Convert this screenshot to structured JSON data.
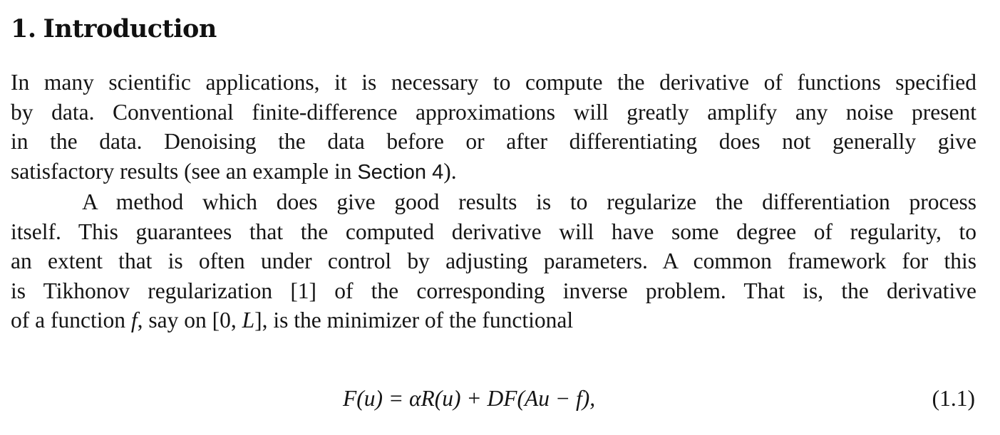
{
  "section": {
    "number": "1.",
    "title": "Introduction"
  },
  "paragraph1": {
    "line1": "In many scientific applications, it is necessary to compute the derivative of functions specified",
    "line2": "by data. Conventional finite-difference approximations will greatly amplify any noise present",
    "line3": "in the data. Denoising the data before or after differentiating does not generally give",
    "line4_pre": "satisfactory results (see an example in ",
    "line4_ref": "Section 4",
    "line4_post": ")."
  },
  "paragraph2": {
    "line1": "A method which does give good results is to regularize the differentiation process",
    "line2": "itself. This guarantees that the computed derivative will have some degree of regularity, to",
    "line3": "an extent that is often under control by adjusting parameters. A common framework for this",
    "line4": "is Tikhonov regularization [1] of the corresponding inverse problem. That is, the derivative",
    "line5_pre": "of a function ",
    "line5_f": "f",
    "line5_mid": ", say on [0, ",
    "line5_L": "L",
    "line5_post": "], is the minimizer of the functional"
  },
  "equation": {
    "text": "F(u) = αR(u) + DF(Au − f),",
    "number": "(1.1)"
  }
}
